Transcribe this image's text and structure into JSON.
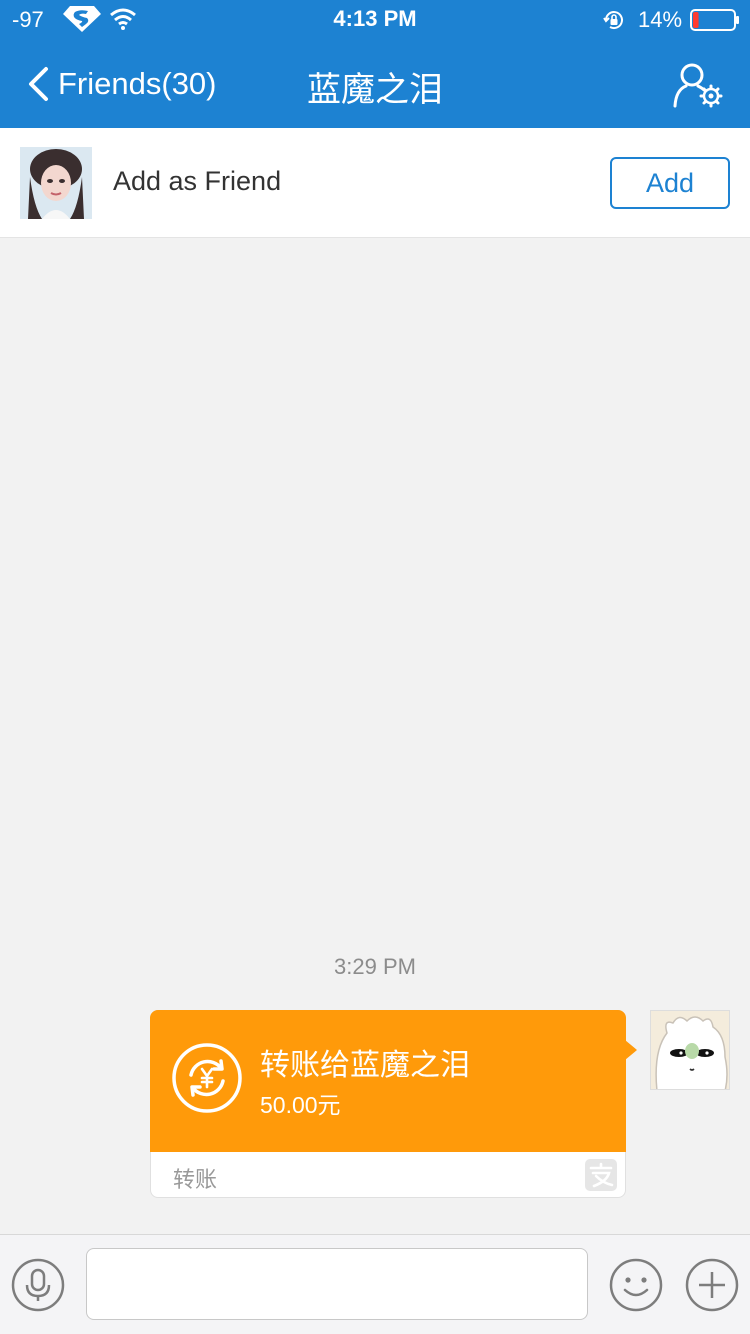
{
  "status_bar": {
    "signal": "-97",
    "carrier_icon": "superman-logo-icon",
    "wifi_icon": "wifi-icon",
    "time": "4:13 PM",
    "rotation_lock_icon": "rotation-lock-icon",
    "battery_percent": "14%",
    "battery_level": 0.14
  },
  "nav": {
    "back_label": "Friends(30)",
    "title": "蓝魔之泪",
    "profile_settings_icon": "profile-settings-icon"
  },
  "friend_prompt": {
    "label": "Add as Friend",
    "add_button_label": "Add"
  },
  "chat": {
    "timestamp": "3:29 PM",
    "transfer": {
      "title": "转账给蓝魔之泪",
      "amount": "50.00元",
      "type_label": "转账",
      "icon": "yuan-transfer-icon",
      "brand_icon": "alipay-icon"
    }
  },
  "input_bar": {
    "voice_icon": "microphone-icon",
    "message_value": "",
    "emoji_icon": "smiley-icon",
    "more_icon": "plus-icon"
  },
  "colors": {
    "header_blue": "#1d82d2",
    "transfer_orange": "#ff9a0a",
    "background": "#f2f2f2"
  }
}
